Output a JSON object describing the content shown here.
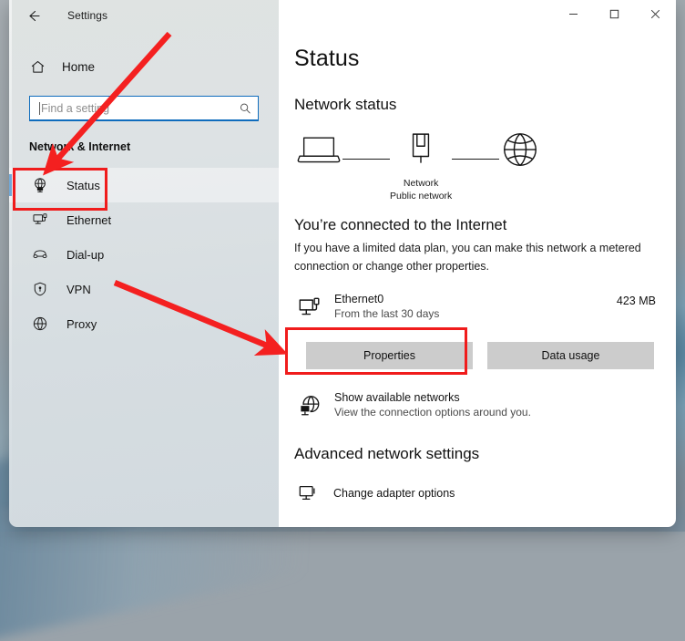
{
  "window": {
    "app_title": "Settings",
    "back_icon": "back-arrow-icon",
    "controls": {
      "minimize": "–",
      "maximize": "☐",
      "close": "✕"
    }
  },
  "sidebar": {
    "home_label": "Home",
    "home_icon": "home-icon",
    "search": {
      "placeholder": "Find a setting",
      "value": "",
      "icon": "search-icon"
    },
    "category_title": "Network & Internet",
    "items": [
      {
        "label": "Status",
        "icon": "network-status-icon",
        "selected": true
      },
      {
        "label": "Ethernet",
        "icon": "ethernet-icon",
        "selected": false
      },
      {
        "label": "Dial-up",
        "icon": "dialup-icon",
        "selected": false
      },
      {
        "label": "VPN",
        "icon": "vpn-shield-icon",
        "selected": false
      },
      {
        "label": "Proxy",
        "icon": "globe-icon",
        "selected": false
      }
    ]
  },
  "main": {
    "page_title": "Status",
    "section_title": "Network status",
    "diagram": {
      "device_icon": "laptop-icon",
      "node_icon": "network-node-icon",
      "internet_icon": "globe-icon",
      "node_label_line1": "Network",
      "node_label_line2": "Public network"
    },
    "connected_heading": "You’re connected to the Internet",
    "connected_description": "If you have a limited data plan, you can make this network a metered connection or change other properties.",
    "adapter": {
      "icon": "ethernet-adapter-icon",
      "name": "Ethernet0",
      "subtitle": "From the last 30 days",
      "data_used": "423 MB"
    },
    "buttons": {
      "properties": "Properties",
      "data_usage": "Data usage"
    },
    "show_networks": {
      "icon": "available-networks-icon",
      "title": "Show available networks",
      "subtitle": "View the connection options around you."
    },
    "advanced_title": "Advanced network settings",
    "advanced_items": [
      {
        "label": "Change adapter options",
        "icon": "monitor-icon"
      }
    ]
  },
  "annotations": {
    "highlight_color": "#f01c1c",
    "highlight_targets": [
      "sidebar-item-status",
      "properties-button"
    ],
    "arrow_count": 2
  },
  "colors": {
    "accent": "#0f6cbd",
    "sidebar_bg": "#dde2e4",
    "content_bg": "#ffffff",
    "button_bg": "#cccccc",
    "annotation_red": "#f01c1c"
  }
}
